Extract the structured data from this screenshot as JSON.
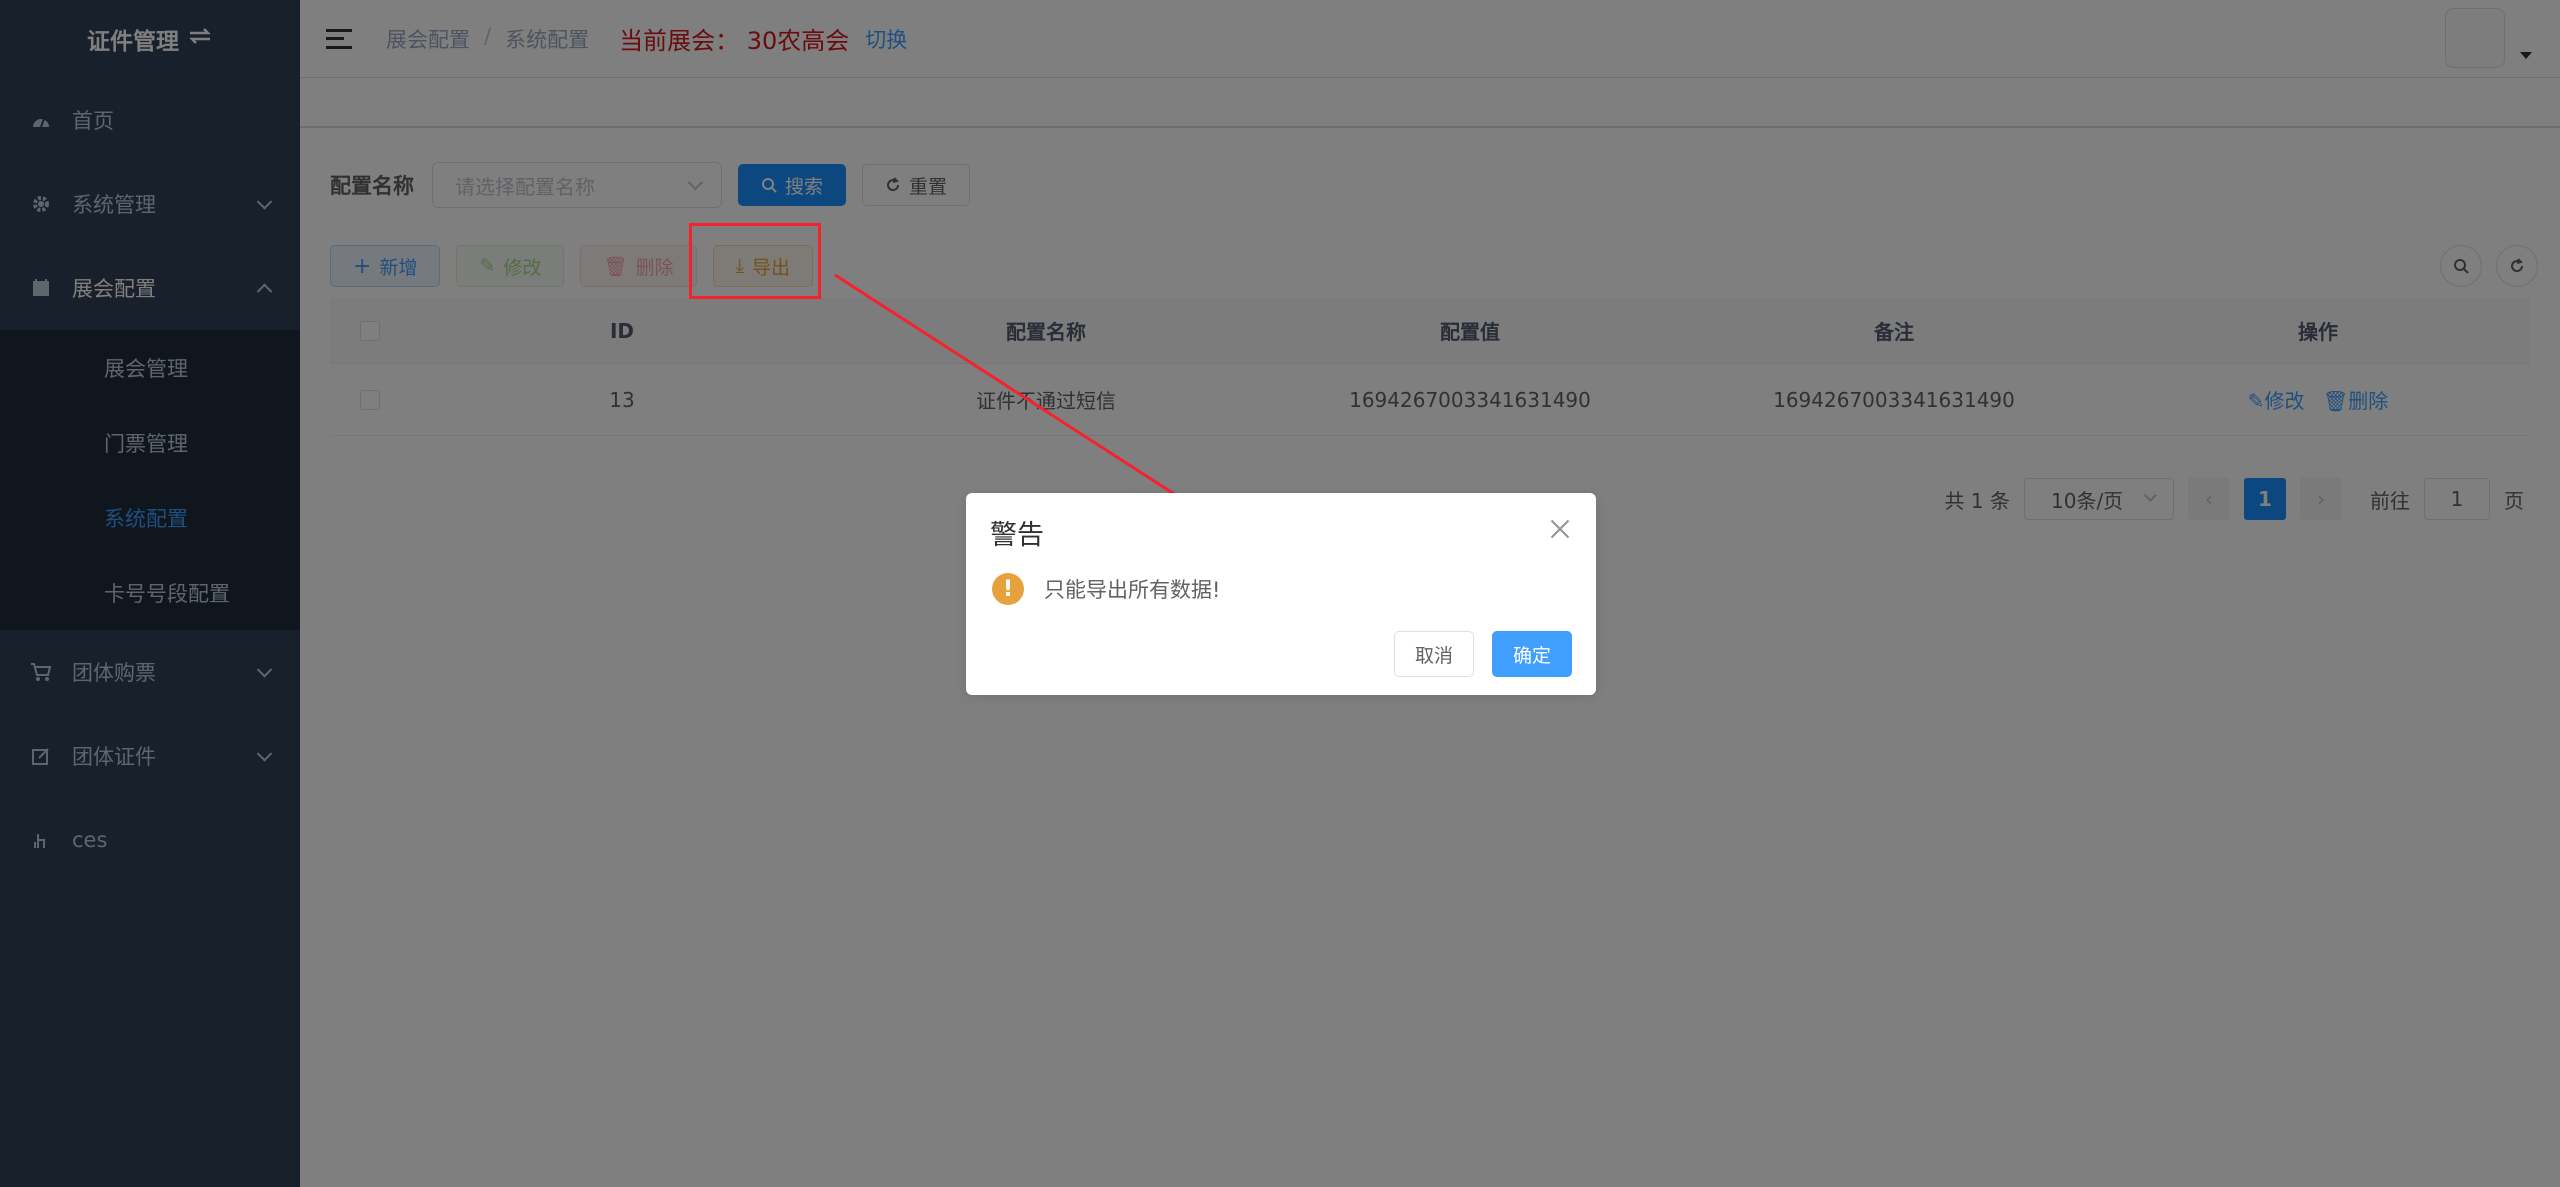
{
  "sidebar": {
    "title": "证件管理",
    "items": [
      {
        "label": "首页"
      },
      {
        "label": "系统管理"
      },
      {
        "label": "展会配置"
      },
      {
        "label": "团体购票"
      },
      {
        "label": "团体证件"
      },
      {
        "label": "ces"
      }
    ],
    "subitems": [
      {
        "label": "展会管理"
      },
      {
        "label": "门票管理"
      },
      {
        "label": "系统配置"
      },
      {
        "label": "卡号号段配置"
      }
    ]
  },
  "header": {
    "breadcrumb": [
      "展会配置",
      "系统配置"
    ],
    "breadcrumb_sep": "/",
    "current_expo": "当前展会：  30农高会",
    "switch_label": "切换"
  },
  "search": {
    "label": "配置名称",
    "placeholder": "请选择配置名称",
    "search_button": "搜索",
    "reset_button": "重置"
  },
  "toolbar": {
    "add": "新增",
    "edit": "修改",
    "delete": "删除",
    "export": "导出"
  },
  "table": {
    "columns": [
      "ID",
      "配置名称",
      "配置值",
      "备注",
      "操作"
    ],
    "rows": [
      {
        "id": "13",
        "name": "证件不通过短信",
        "value": "1694267003341631490",
        "remark": "1694267003341631490",
        "edit": "修改",
        "delete": "删除"
      }
    ]
  },
  "pagination": {
    "total": "共 1 条",
    "page_size": "10条/页",
    "current_page": "1",
    "goto_label": "前往",
    "goto_value": "1",
    "page_suffix": "页"
  },
  "dialog": {
    "title": "警告",
    "message": "只能导出所有数据!",
    "cancel": "取消",
    "confirm": "确定"
  },
  "colors": {
    "sidebar_bg": "#304156",
    "primary": "#1890ff",
    "highlight": "#f5222d",
    "current_expo": "#d5171d"
  }
}
